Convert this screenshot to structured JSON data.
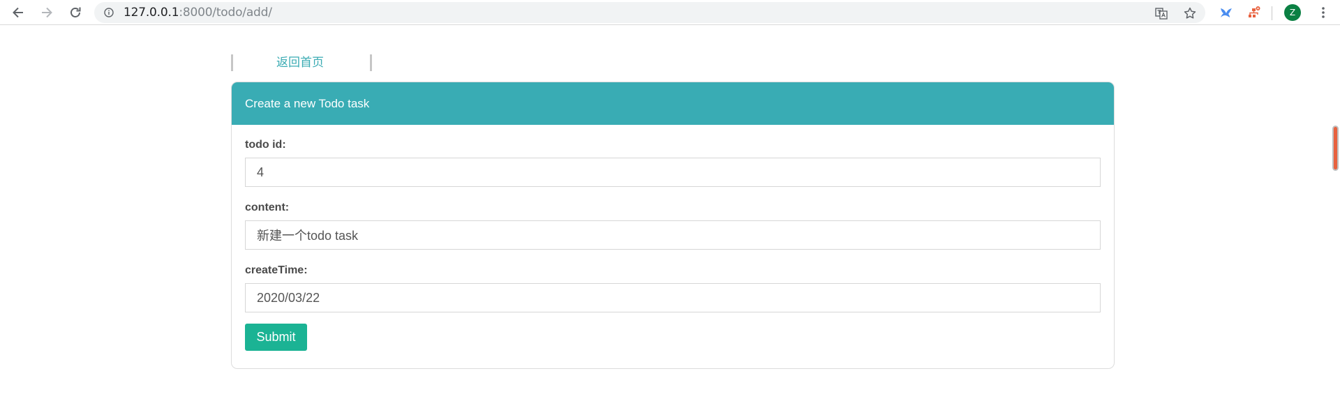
{
  "browser": {
    "url_host": "127.0.0.1",
    "url_path": ":8000/todo/add/",
    "profile_initial": "Z"
  },
  "nav": {
    "home_link": "返回首页"
  },
  "form": {
    "title": "Create a new Todo task",
    "fields": [
      {
        "label": "todo id:",
        "value": "4"
      },
      {
        "label": "content:",
        "value": "新建一个todo task"
      },
      {
        "label": "createTime:",
        "value": "2020/03/22"
      }
    ],
    "submit_label": "Submit"
  },
  "colors": {
    "header": "#39acb4",
    "submit": "#1bb394",
    "link": "#3aabb3"
  }
}
